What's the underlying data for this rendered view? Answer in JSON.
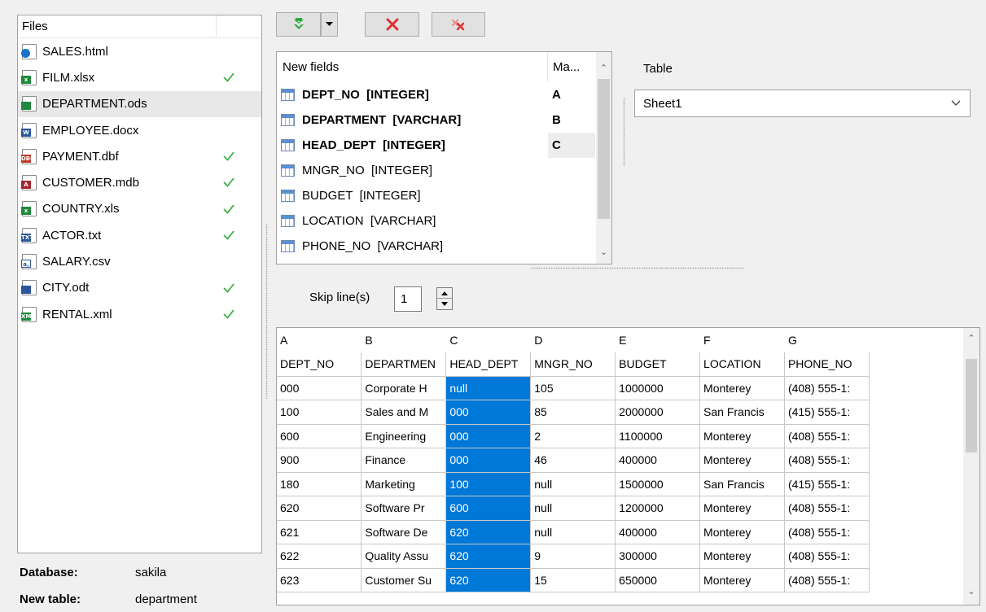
{
  "files": {
    "header": "Files",
    "items": [
      {
        "name": "SALES.html",
        "type": "html",
        "checked": false,
        "selected": false
      },
      {
        "name": "FILM.xlsx",
        "type": "xlsx",
        "checked": true,
        "selected": false
      },
      {
        "name": "DEPARTMENT.ods",
        "type": "ods",
        "checked": false,
        "selected": true
      },
      {
        "name": "EMPLOYEE.docx",
        "type": "docx",
        "checked": false,
        "selected": false
      },
      {
        "name": "PAYMENT.dbf",
        "type": "dbf",
        "checked": true,
        "selected": false
      },
      {
        "name": "CUSTOMER.mdb",
        "type": "mdb",
        "checked": true,
        "selected": false
      },
      {
        "name": "COUNTRY.xls",
        "type": "xls",
        "checked": true,
        "selected": false
      },
      {
        "name": "ACTOR.txt",
        "type": "txt",
        "checked": true,
        "selected": false
      },
      {
        "name": "SALARY.csv",
        "type": "csv",
        "checked": false,
        "selected": false
      },
      {
        "name": "CITY.odt",
        "type": "odt",
        "checked": true,
        "selected": false
      },
      {
        "name": "RENTAL.xml",
        "type": "xml",
        "checked": true,
        "selected": false
      }
    ]
  },
  "info": {
    "database_label": "Database:",
    "database_value": "sakila",
    "new_table_label": "New table:",
    "new_table_value": "department"
  },
  "toolbar": {
    "add_icon": "green-down-arrow-icon",
    "dropdown_icon": "chevron-down-icon",
    "remove_icon": "red-x-icon",
    "remove_all_icon": "red-double-x-icon"
  },
  "fields": {
    "header_name": "New fields",
    "header_map": "Ma...",
    "items": [
      {
        "name": "DEPT_NO  [INTEGER]",
        "map": "A",
        "bold": true
      },
      {
        "name": "DEPARTMENT  [VARCHAR]",
        "map": "B",
        "bold": true
      },
      {
        "name": "HEAD_DEPT  [INTEGER]",
        "map": "C",
        "bold": true
      },
      {
        "name": "MNGR_NO  [INTEGER]",
        "map": "",
        "bold": false
      },
      {
        "name": "BUDGET  [INTEGER]",
        "map": "",
        "bold": false
      },
      {
        "name": "LOCATION  [VARCHAR]",
        "map": "",
        "bold": false
      },
      {
        "name": "PHONE_NO  [VARCHAR]",
        "map": "",
        "bold": false
      }
    ]
  },
  "table": {
    "label": "Table",
    "selected": "Sheet1"
  },
  "skip": {
    "label": "Skip line(s)",
    "value": "1"
  },
  "grid": {
    "letters": [
      "A",
      "B",
      "C",
      "D",
      "E",
      "F",
      "G"
    ],
    "headers": [
      "DEPT_NO",
      "DEPARTMEN",
      "HEAD_DEPT",
      "MNGR_NO",
      "BUDGET",
      "LOCATION",
      "PHONE_NO"
    ],
    "rows": [
      [
        "000",
        "Corporate H",
        "null",
        "105",
        "1000000",
        "Monterey",
        "(408) 555-1:"
      ],
      [
        "100",
        "Sales and M",
        "000",
        "85",
        "2000000",
        "San Francis",
        "(415) 555-1:"
      ],
      [
        "600",
        "Engineering",
        "000",
        "2",
        "1100000",
        "Monterey",
        "(408) 555-1:"
      ],
      [
        "900",
        "Finance",
        "000",
        "46",
        "400000",
        "Monterey",
        "(408) 555-1:"
      ],
      [
        "180",
        "Marketing",
        "100",
        "null",
        "1500000",
        "San Francis",
        "(415) 555-1:"
      ],
      [
        "620",
        "Software Pr",
        "600",
        "null",
        "1200000",
        "Monterey",
        "(408) 555-1:"
      ],
      [
        "621",
        "Software De",
        "620",
        "null",
        "400000",
        "Monterey",
        "(408) 555-1:"
      ],
      [
        "622",
        "Quality Assu",
        "620",
        "9",
        "300000",
        "Monterey",
        "(408) 555-1:"
      ],
      [
        "623",
        "Customer Su",
        "620",
        "15",
        "650000",
        "Monterey",
        "(408) 555-1:"
      ]
    ],
    "selected_column_index": 2
  },
  "colors": {
    "selection": "#0078d7",
    "check": "#3cb043",
    "delete_red": "#e03030",
    "arrow_green": "#2eab3a"
  }
}
